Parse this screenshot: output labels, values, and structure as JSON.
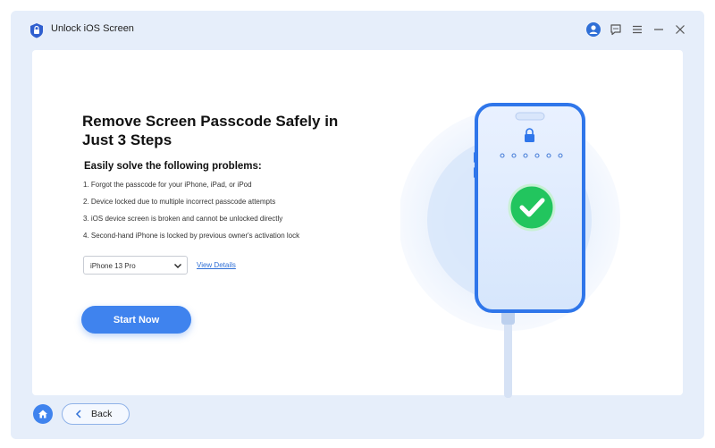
{
  "window": {
    "title": "Unlock iOS Screen",
    "icons": [
      "app-logo",
      "user-icon",
      "chat-icon",
      "menu-icon",
      "minimize-icon",
      "close-icon"
    ]
  },
  "main": {
    "heading": "Remove Screen Passcode Safely in Just 3 Steps",
    "subheading": "Easily solve the following problems:",
    "problems": [
      "1. Forgot the passcode for your iPhone, iPad, or iPod",
      "2. Device locked due to multiple incorrect passcode attempts",
      "3. iOS device screen is broken and cannot be unlocked directly",
      "4. Second-hand iPhone is locked by previous owner's activation lock"
    ],
    "device_select": {
      "value": "iPhone 13 Pro"
    },
    "view_details_label": "View Details",
    "start_button_label": "Start Now"
  },
  "footer": {
    "back_label": "Back"
  },
  "colors": {
    "accent": "#3f83ee",
    "window_bg": "#e6eefa",
    "panel_bg": "#ffffff",
    "success": "#22c55e",
    "link": "#2f6fd6"
  }
}
